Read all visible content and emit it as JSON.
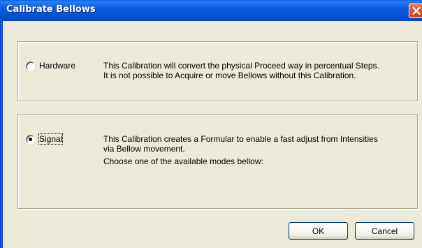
{
  "window": {
    "title": "Calibrate Bellows"
  },
  "hardware": {
    "label": "Hardware",
    "checked": false,
    "description_lines": [
      "This Calibration will convert the physical Proceed way in percentual Steps.",
      "It is not possible to Acquire or move Bellows without this Calibration."
    ]
  },
  "signal": {
    "label": "Signal",
    "checked": true,
    "description_lines": [
      "This Calibration creates a Formular to enable a fast adjust from Intensities",
      "via Bellow movement.",
      "Choose one of the available modes bellow:"
    ]
  },
  "buttons": {
    "ok": "OK",
    "cancel": "Cancel"
  },
  "icons": {
    "close": "close-icon"
  },
  "colors": {
    "titlebar": "#0a5ae0",
    "close_button": "#d9542a",
    "dialog_background": "#ece9d8"
  }
}
